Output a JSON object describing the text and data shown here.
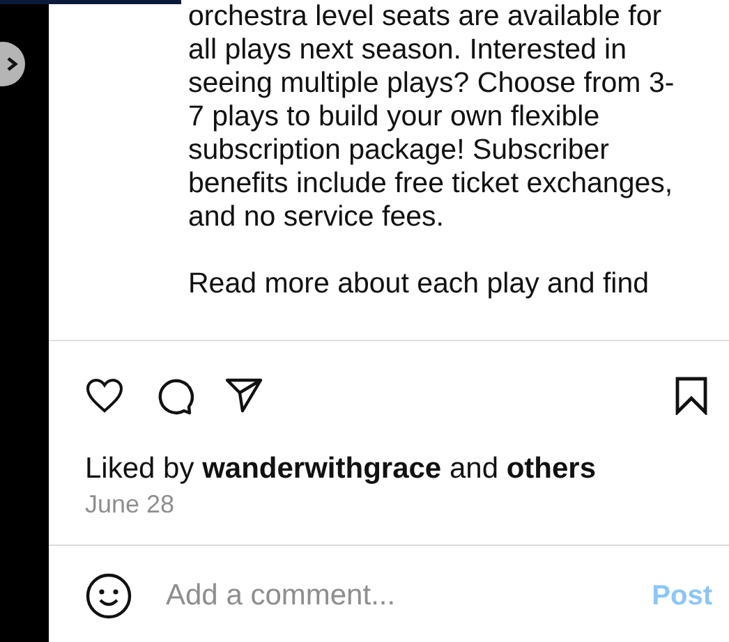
{
  "caption": {
    "paragraphs": [
      "orchestra level seats are available for all plays next season. Interested in seeing multiple plays? Choose from 3-7 plays to build your own flexible subscription package! Subscriber benefits include free ticket exchanges, and no service fees.",
      "Read more about each play and find"
    ]
  },
  "actions": {
    "liked": false,
    "saved": false
  },
  "likes": "Liked by **wanderwithgrace** and **others**",
  "date": "June 28",
  "comment": {
    "placeholder": "Add a comment...",
    "post": "Post",
    "post_disabled": true
  }
}
